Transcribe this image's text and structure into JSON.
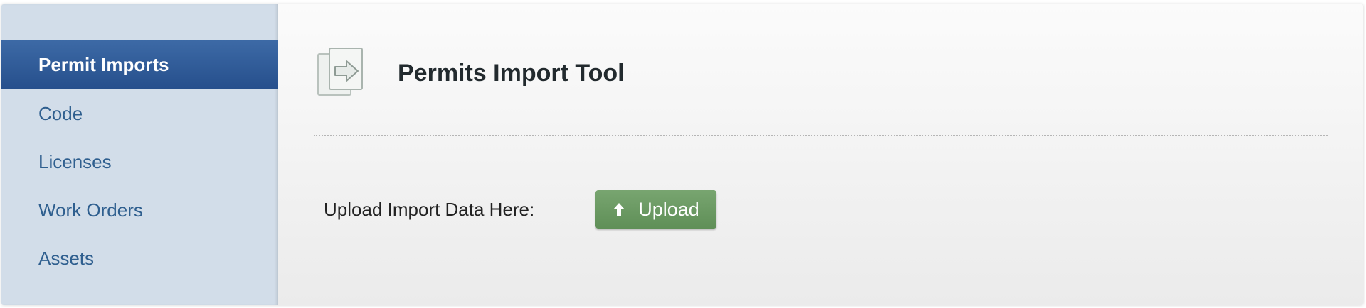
{
  "sidebar": {
    "items": [
      {
        "label": "Permit Imports",
        "active": true
      },
      {
        "label": "Code",
        "active": false
      },
      {
        "label": "Licenses",
        "active": false
      },
      {
        "label": "Work Orders",
        "active": false
      },
      {
        "label": "Assets",
        "active": false
      }
    ]
  },
  "header": {
    "icon": "import-document-icon",
    "title": "Permits Import Tool"
  },
  "upload": {
    "label": "Upload Import Data Here:",
    "button_label": "Upload",
    "button_icon": "upload-arrow-icon"
  },
  "colors": {
    "sidebar_bg": "#d2dde9",
    "active_item": "#2d5a98",
    "link_text": "#2f5f8f",
    "button_green": "#6b9a63"
  }
}
